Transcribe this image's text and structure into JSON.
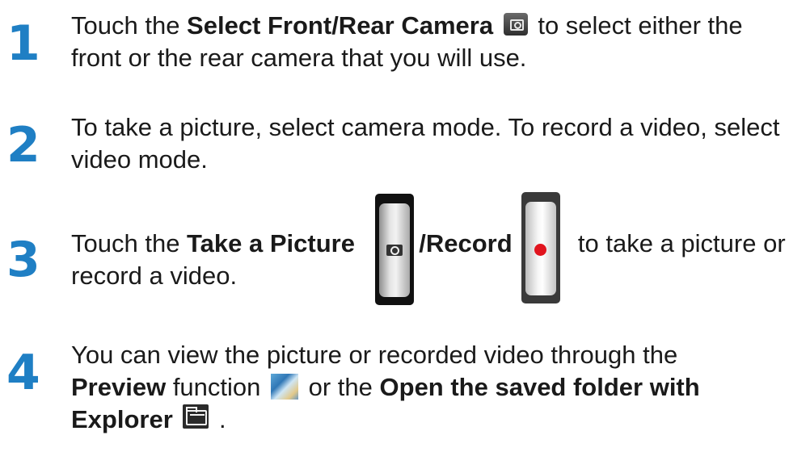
{
  "steps": [
    {
      "number": "1",
      "line1": {
        "pre": "Touch the ",
        "bold": "Select Front/Rear Camera",
        "post": " to select either the"
      },
      "line2": "front or the rear camera that you will use."
    },
    {
      "number": "2",
      "line1": "To take a picture, select camera mode. To record a video, select",
      "line2": "video mode."
    },
    {
      "number": "3",
      "line1": {
        "pre": "Touch the ",
        "bold1": "Take a Picture",
        "bold2": "/Record",
        "post": "to take a picture or"
      },
      "line2": "record a video."
    },
    {
      "number": "4",
      "line1": "You can view the picture or recorded video through the",
      "line2": {
        "bold": "Preview",
        "mid": " function ",
        "post": " or the ",
        "bold2": "Open the saved folder with"
      },
      "line3": {
        "bold": "Explorer",
        "post": " ."
      }
    }
  ],
  "icons": {
    "switch_camera": "switch-camera-icon",
    "take_picture": "camera-shutter-icon",
    "record": "record-icon",
    "preview": "preview-icon",
    "explorer": "folder-explorer-icon"
  },
  "colors": {
    "step_number": "#1f7fc4",
    "text": "#1a1a1a",
    "record_dot": "#e1141e"
  }
}
